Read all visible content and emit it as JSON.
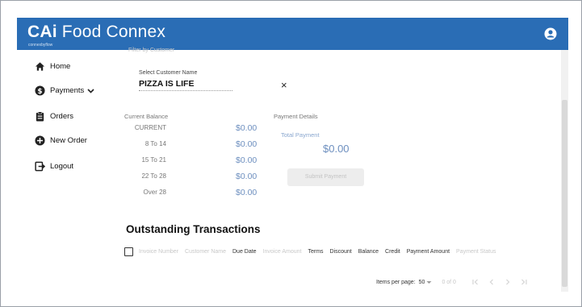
{
  "app": {
    "name_prefix": "CAi",
    "name_rest": " Food Connex",
    "brand_sub": "connexbyflow"
  },
  "colors": {
    "header": "#2a6db5",
    "money": "#6d8fbf"
  },
  "nav": [
    {
      "label": "Home",
      "icon": "home-icon"
    },
    {
      "label": "Payments",
      "icon": "dollar-icon"
    },
    {
      "label": "Orders",
      "icon": "clipboard-icon"
    },
    {
      "label": "New Order",
      "icon": "plus-circle-icon"
    },
    {
      "label": "Logout",
      "icon": "logout-icon"
    }
  ],
  "filter": {
    "title": "Filter by Customer",
    "label": "Select Customer Name",
    "value": "PIZZA IS LIFE",
    "clear": "×"
  },
  "balance": {
    "title": "Current Balance",
    "rows": [
      {
        "label": "CURRENT",
        "amount": "$0.00"
      },
      {
        "label": "8 To 14",
        "amount": "$0.00"
      },
      {
        "label": "15 To 21",
        "amount": "$0.00"
      },
      {
        "label": "22 To 28",
        "amount": "$0.00"
      },
      {
        "label": "Over 28",
        "amount": "$0.00"
      }
    ]
  },
  "payment": {
    "title": "Payment Details",
    "total_label": "Total Payment",
    "total_value": "$0.00",
    "submit_label": "Submit Payment"
  },
  "transactions": {
    "title": "Outstanding Transactions",
    "columns": [
      {
        "label": "Invoice Number",
        "faint": true
      },
      {
        "label": "Customer Name",
        "faint": true
      },
      {
        "label": "Due Date",
        "faint": false
      },
      {
        "label": "Invoice Amount",
        "faint": true
      },
      {
        "label": "Terms",
        "faint": false
      },
      {
        "label": "Discount",
        "faint": false
      },
      {
        "label": "Balance",
        "faint": false
      },
      {
        "label": "Credit",
        "faint": false
      },
      {
        "label": "Payment Amount",
        "faint": false
      },
      {
        "label": "Payment Status",
        "faint": true
      }
    ],
    "items_per_page_label": "Items per page:",
    "items_per_page_value": "50",
    "range_text": "0 of 0"
  }
}
